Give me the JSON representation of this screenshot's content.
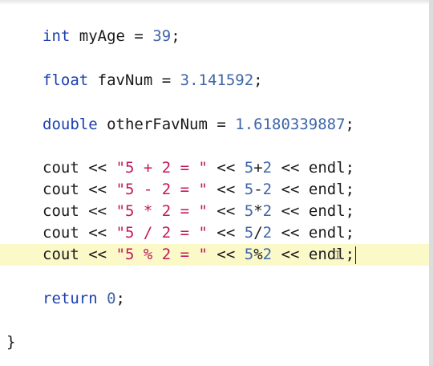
{
  "editor": {
    "lines": [
      {
        "kind": "decl",
        "type": "int",
        "name": "myAge",
        "value": "39"
      },
      {
        "kind": "decl",
        "type": "float",
        "name": "favNum",
        "value": "3.141592"
      },
      {
        "kind": "decl",
        "type": "double",
        "name": "otherFavNum",
        "value": "1.6180339887"
      },
      {
        "kind": "cout",
        "cout": "cout",
        "op": "<<",
        "str": "\"5 + 2 = \"",
        "a": "5",
        "sym": "+",
        "b": "2",
        "endl": "endl;"
      },
      {
        "kind": "cout",
        "cout": "cout",
        "op": "<<",
        "str": "\"5 - 2 = \"",
        "a": "5",
        "sym": "-",
        "b": "2",
        "endl": "endl;"
      },
      {
        "kind": "cout",
        "cout": "cout",
        "op": "<<",
        "str": "\"5 * 2 = \"",
        "a": "5",
        "sym": "*",
        "b": "2",
        "endl": "endl;"
      },
      {
        "kind": "cout",
        "cout": "cout",
        "op": "<<",
        "str": "\"5 / 2 = \"",
        "a": "5",
        "sym": "/",
        "b": "2",
        "endl": "endl;"
      },
      {
        "kind": "cout",
        "cout": "cout",
        "op": "<<",
        "str": "\"5 % 2 = \"",
        "a": "5",
        "sym": "%",
        "b": "2",
        "endl": "endl;"
      },
      {
        "kind": "return",
        "keyword": "return",
        "value": "0",
        "end": ";"
      },
      {
        "kind": "brace",
        "text": "}"
      }
    ],
    "current_line_index": 7,
    "colors": {
      "keyword": "#1a3fb0",
      "number": "#3e66a8",
      "string": "#c2185b",
      "current_line_bg": "#fbf9c8"
    }
  }
}
